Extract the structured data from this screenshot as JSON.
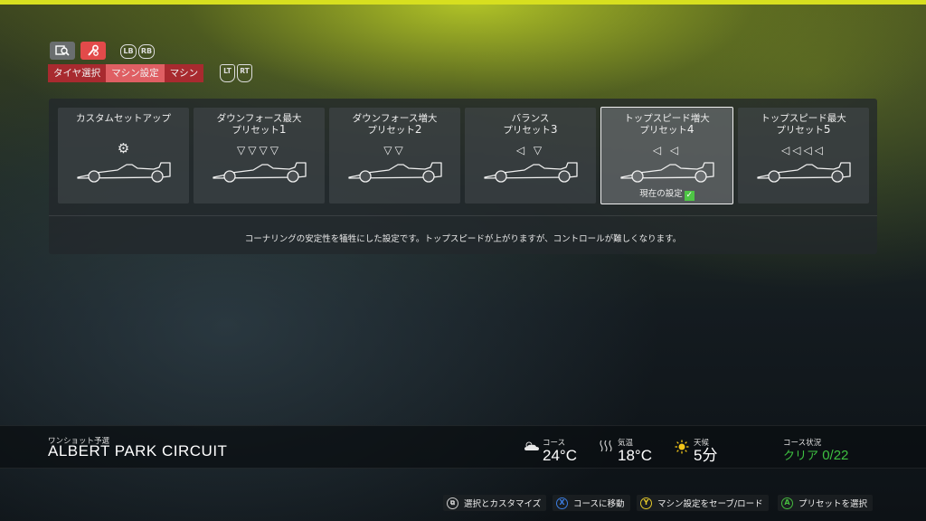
{
  "toolbar": {
    "icons": [
      "search-settings-icon",
      "wrench-icon"
    ],
    "bumper_left": "LB",
    "bumper_right": "RB"
  },
  "tabs": [
    {
      "label": "タイヤ選択"
    },
    {
      "label": "マシン設定"
    },
    {
      "label": "マシン"
    }
  ],
  "triggers": {
    "left": "LT",
    "right": "RT"
  },
  "presets": [
    {
      "title": "カスタムセットアップ",
      "sub": "",
      "num": "",
      "marks": "⚙",
      "current": ""
    },
    {
      "title": "ダウンフォース最大",
      "sub": "プリセット",
      "num": "1",
      "marks": "▽▽▽▽",
      "current": ""
    },
    {
      "title": "ダウンフォース増大",
      "sub": "プリセット",
      "num": "2",
      "marks": "▽▽",
      "current": ""
    },
    {
      "title": "バランス",
      "sub": "プリセット",
      "num": "3",
      "marks": "◁ ▽",
      "current": ""
    },
    {
      "title": "トップスピード増大",
      "sub": "プリセット",
      "num": "4",
      "marks": "◁ ◁",
      "current": "現在の設定"
    },
    {
      "title": "トップスピード最大",
      "sub": "プリセット",
      "num": "5",
      "marks": "◁◁◁◁",
      "current": ""
    }
  ],
  "selected_index": 4,
  "description": "コーナリングの安定性を犠牲にした設定です。トップスピードが上がりますが、コントロールが難しくなります。",
  "session": {
    "type": "ワンショット予選",
    "circuit": "ALBERT PARK CIRCUIT",
    "track_temp_label": "コース",
    "track_temp": "24°C",
    "air_temp_label": "気温",
    "air_temp": "18°C",
    "weather_label": "天候",
    "weather": "5分",
    "track_status_label": "コース状況",
    "track_status_prefix": "クリア",
    "track_status_value": "0/22"
  },
  "footer": {
    "select_customize": "選択とカスタマイズ",
    "move_course": "コースに移動",
    "save_load": "マシン設定をセーブ/ロード",
    "select_preset": "プリセットを選択",
    "btn_x": "X",
    "btn_y": "Y",
    "btn_a": "A"
  },
  "colors": {
    "accent_yellow": "#d7df1f",
    "tab_red": "#a82a2f",
    "tab_active": "#df5f63",
    "status_green": "#3ec041"
  }
}
